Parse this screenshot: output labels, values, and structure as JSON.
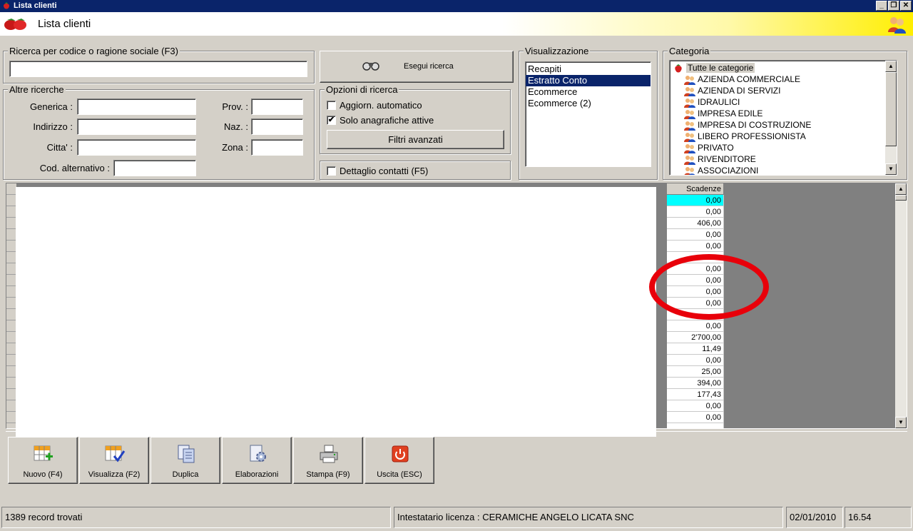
{
  "window": {
    "title": "Lista clienti",
    "header_title": "Lista clienti"
  },
  "search": {
    "group_label": "Ricerca per codice o ragione sociale (F3)",
    "value": "",
    "button_label": "Esegui ricerca"
  },
  "other_searches": {
    "group_label": "Altre ricerche",
    "generica_label": "Generica :",
    "indirizzo_label": "Indirizzo :",
    "citta_label": "Citta' :",
    "prov_label": "Prov. :",
    "naz_label": "Naz. :",
    "zona_label": "Zona :",
    "cod_alt_label": "Cod. alternativo :"
  },
  "options": {
    "group_label": "Opzioni di ricerca",
    "auto_update_label": "Aggiorn. automatico",
    "auto_update_checked": false,
    "active_only_label": "Solo anagrafiche attive",
    "active_only_checked": true,
    "advanced_filters_label": "Filtri avanzati",
    "contact_detail_label": "Dettaglio contatti (F5)",
    "contact_detail_checked": false
  },
  "view": {
    "group_label": "Visualizzazione",
    "items": [
      "Recapiti",
      "Estratto Conto",
      "Ecommerce",
      "Ecommerce (2)"
    ],
    "selected": "Estratto Conto"
  },
  "category": {
    "group_label": "Categoria",
    "root": "Tutte le categorie",
    "items": [
      "AZIENDA COMMERCIALE",
      "AZIENDA DI SERVIZI",
      "IDRAULICI",
      "IMPRESA EDILE",
      "IMPRESA DI COSTRUZIONE",
      "LIBERO PROFESSIONISTA",
      "PRIVATO",
      "RIVENDITORE",
      "ASSOCIAZIONI"
    ]
  },
  "grid": {
    "column_header": "Scadenze",
    "values": [
      "0,00",
      "0,00",
      "406,00",
      "0,00",
      "0,00",
      "",
      "0,00",
      "0,00",
      "0,00",
      "0,00",
      "",
      "0,00",
      "2'700,00",
      "11,49",
      "0,00",
      "25,00",
      "394,00",
      "177,43",
      "0,00",
      "0,00",
      ""
    ]
  },
  "toolbar": {
    "buttons": [
      {
        "label": "Nuovo (F4)",
        "icon": "new-record-icon"
      },
      {
        "label": "Visualizza (F2)",
        "icon": "view-record-icon"
      },
      {
        "label": "Duplica",
        "icon": "duplicate-icon"
      },
      {
        "label": "Elaborazioni",
        "icon": "processing-icon"
      },
      {
        "label": "Stampa (F9)",
        "icon": "printer-icon"
      },
      {
        "label": "Uscita (ESC)",
        "icon": "power-icon"
      }
    ]
  },
  "status": {
    "records": "1389 record trovati",
    "license": "Intestatario licenza : CERAMICHE ANGELO LICATA SNC",
    "date": "02/01/2010",
    "time": "16.54"
  },
  "colors": {
    "title_bar": "#0a246a",
    "selection": "#0a246a",
    "active_cell": "#00ffff",
    "annotation": "#e8000a"
  }
}
